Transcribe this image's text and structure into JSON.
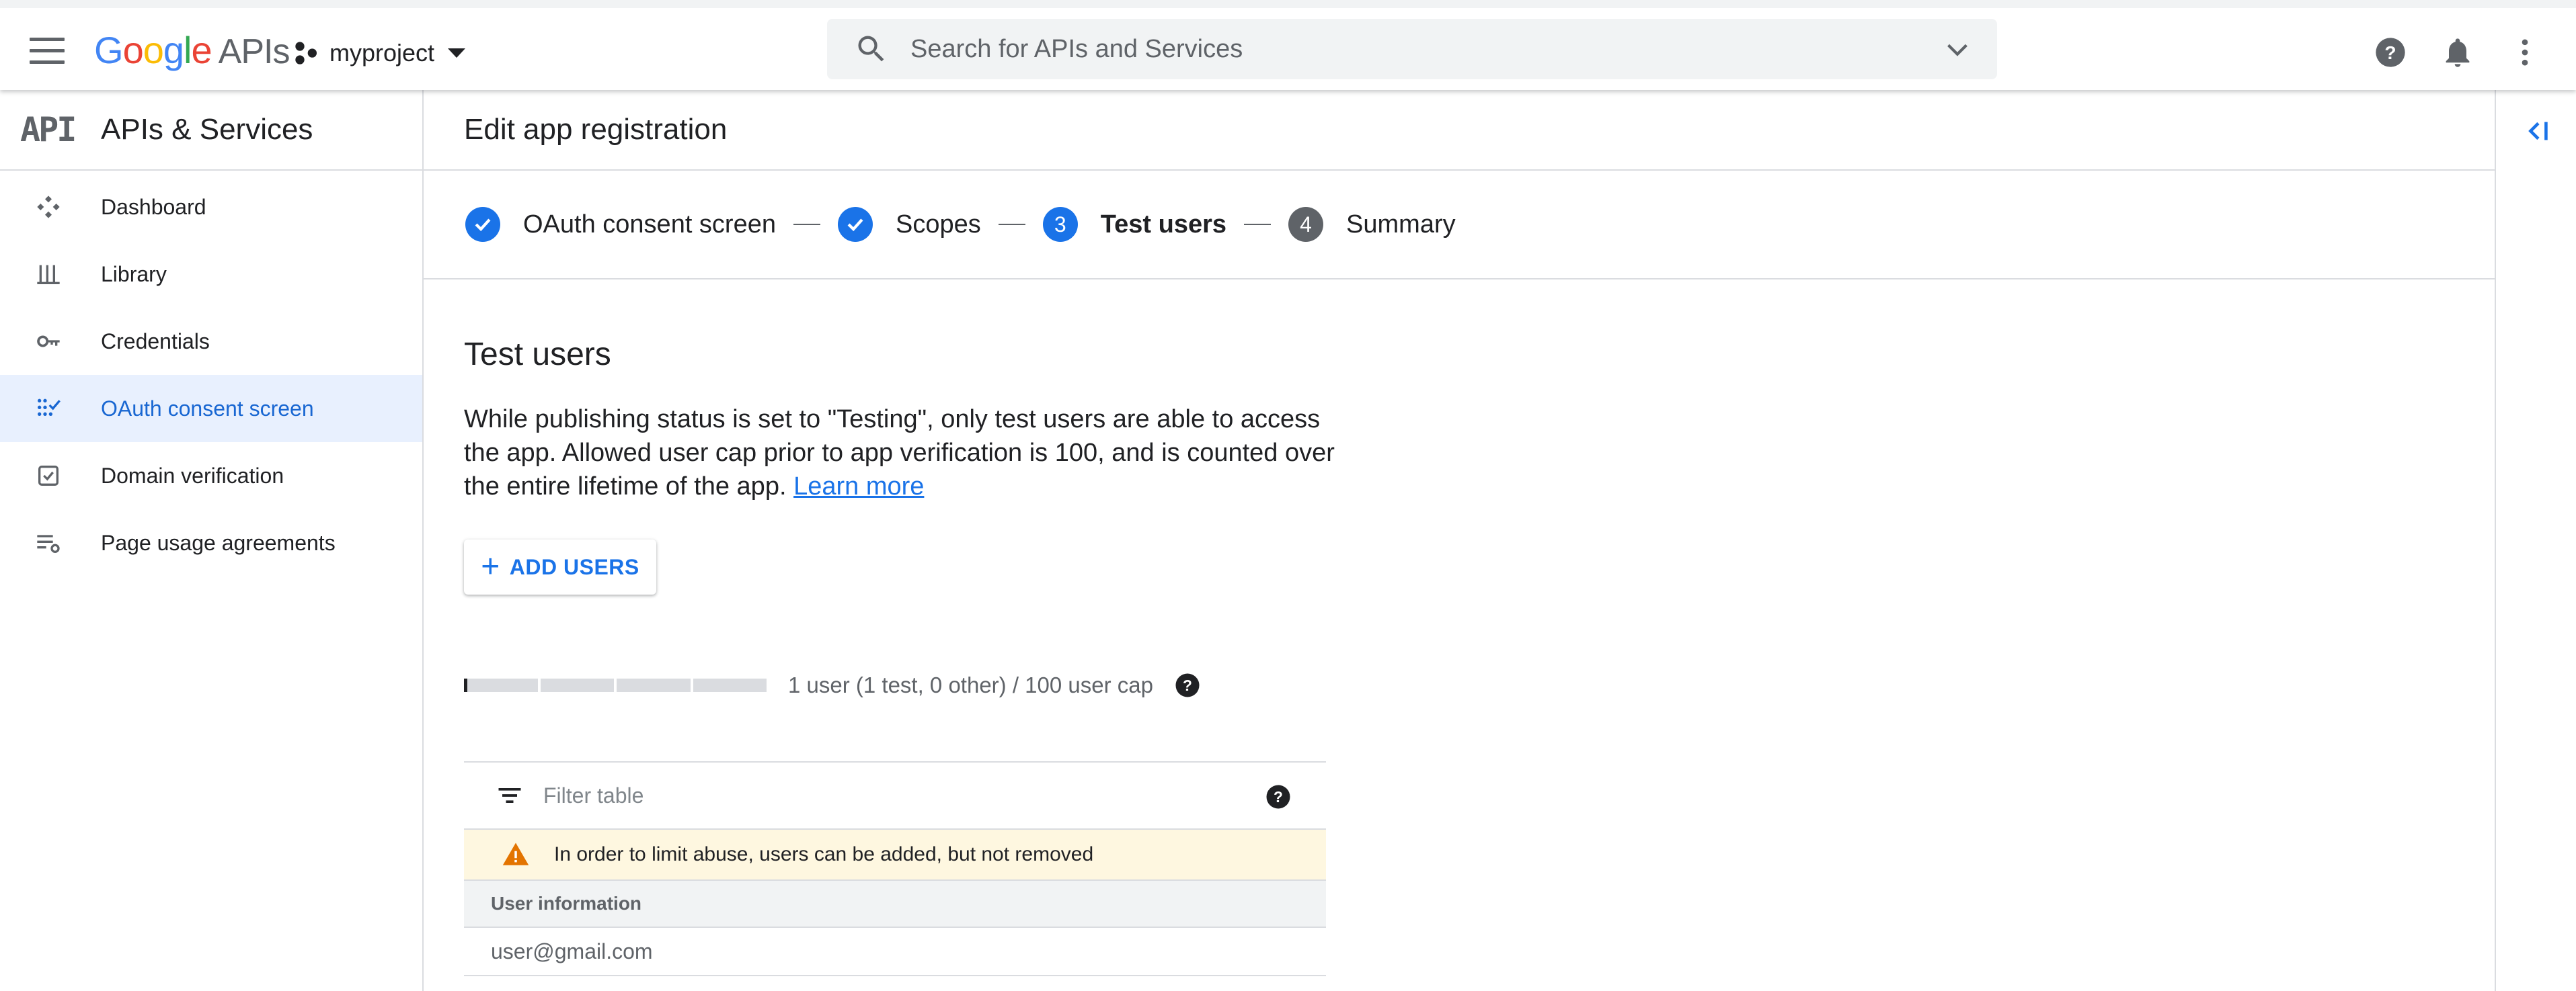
{
  "topbar": {
    "logo_google": [
      "G",
      "o",
      "o",
      "g",
      "l",
      "e"
    ],
    "logo_apis": "APIs",
    "project_name": "myproject",
    "search_placeholder": "Search for APIs and Services"
  },
  "sidebar": {
    "title": "APIs & Services",
    "api_logo": "API",
    "items": [
      {
        "label": "Dashboard",
        "icon": "dashboard-icon"
      },
      {
        "label": "Library",
        "icon": "library-icon"
      },
      {
        "label": "Credentials",
        "icon": "key-icon"
      },
      {
        "label": "OAuth consent screen",
        "icon": "oauth-icon",
        "active": true
      },
      {
        "label": "Domain verification",
        "icon": "checkbox-icon"
      },
      {
        "label": "Page usage agreements",
        "icon": "settings-list-icon"
      }
    ]
  },
  "main": {
    "header": "Edit app registration",
    "steps": [
      {
        "label": "OAuth consent screen",
        "state": "done",
        "number": "1"
      },
      {
        "label": "Scopes",
        "state": "done",
        "number": "2"
      },
      {
        "label": "Test users",
        "state": "current",
        "number": "3"
      },
      {
        "label": "Summary",
        "state": "todo",
        "number": "4"
      }
    ],
    "section_title": "Test users",
    "description": "While publishing status is set to \"Testing\", only test users are able to access the app. Allowed user cap prior to app verification is 100, and is counted over the entire lifetime of the app.",
    "learn_more": "Learn more",
    "add_users_label": "ADD USERS",
    "usage_text": "1 user (1 test, 0 other) / 100 user cap",
    "usage_fraction": 0.01,
    "filter_placeholder": "Filter table",
    "warning_text": "In order to limit abuse, users can be added, but not removed",
    "table_header": "User information",
    "table_rows": [
      "user@gmail.com"
    ]
  },
  "colors": {
    "accent": "#1a73e8",
    "active_bg": "#e8f0fe",
    "warning_bg": "#fef7e0",
    "warning_icon": "#e37400"
  }
}
